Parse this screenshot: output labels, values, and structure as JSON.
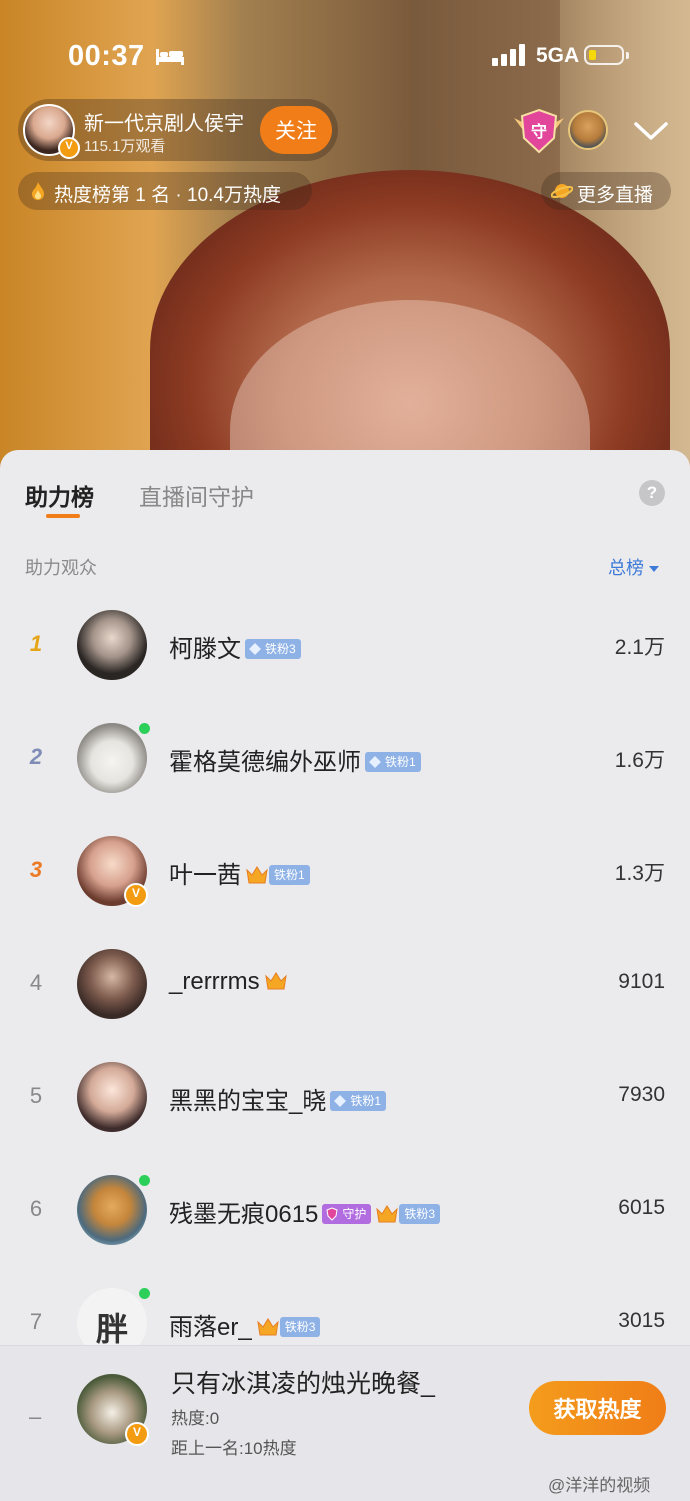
{
  "status_bar": {
    "time": "00:37",
    "network": "5GA"
  },
  "streamer": {
    "name": "新一代京剧人侯宇",
    "viewers": "115.1万观看",
    "follow_label": "关注",
    "verified_mark": "V"
  },
  "heat_info": "热度榜第 1 名 · 10.4万热度",
  "more_live": "更多直播",
  "guard_badge_char": "守",
  "tabs": {
    "active": "助力榜",
    "inactive": "直播间守护"
  },
  "help_mark": "?",
  "section_label": "助力观众",
  "total_label": "总榜",
  "ranking": [
    {
      "rank": "1",
      "name": "柯滕文",
      "badge": "铁粉3",
      "score": "2.1万"
    },
    {
      "rank": "2",
      "name": "霍格莫德编外巫师",
      "badge": "铁粉1",
      "score": "1.6万"
    },
    {
      "rank": "3",
      "name": "叶一茜",
      "badge": "铁粉1",
      "score": "1.3万"
    },
    {
      "rank": "4",
      "name": "_rerrrms",
      "score": "9101"
    },
    {
      "rank": "5",
      "name": "黑黑的宝宝_晓",
      "badge": "铁粉1",
      "score": "7930"
    },
    {
      "rank": "6",
      "name": "残墨无痕0615",
      "guard_badge": "守护",
      "badge": "铁粉3",
      "score": "6015"
    },
    {
      "rank": "7",
      "name": "雨落er_",
      "badge": "铁粉3",
      "score": "3015",
      "avatar_char": "胖"
    }
  ],
  "my_rank": {
    "rank": "–",
    "name": "只有冰淇凌的烛光晚餐_",
    "heat": "热度:0",
    "gap": "距上一名:10热度",
    "button": "获取热度"
  },
  "watermark": "@洋洋的视频",
  "colors": {
    "accent": "#f07d17",
    "link": "#3e7bd8",
    "online": "#2dcf5b",
    "iron_badge": "#8eb1e6",
    "guard_badge": "#b16ce0"
  }
}
